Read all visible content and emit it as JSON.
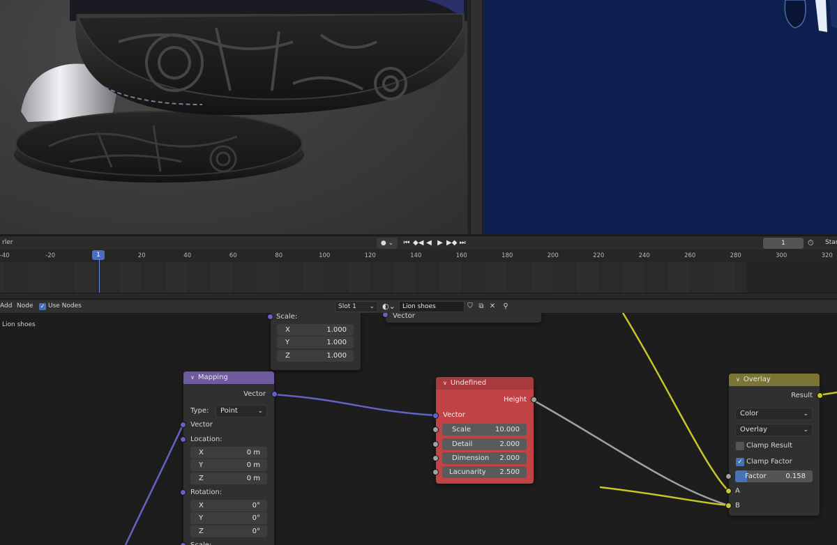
{
  "timeline": {
    "editor_label": "rler",
    "record_label": "● ⌄",
    "playback_icons": [
      "⏮",
      "◆◀",
      "◀",
      "▶",
      "▶◆",
      "⏭"
    ],
    "current_frame": "1",
    "start_label": "Star",
    "ruler_ticks": [
      "-40",
      "-20",
      "1",
      "20",
      "40",
      "60",
      "80",
      "100",
      "120",
      "140",
      "160",
      "180",
      "200",
      "220",
      "240",
      "260",
      "280",
      "300",
      "320"
    ],
    "playhead_frame": "1"
  },
  "node_header": {
    "menu_add": "Add",
    "menu_node": "Node",
    "use_nodes_label": "Use Nodes",
    "slot": "Slot 1",
    "material_name": "Lion shoes"
  },
  "breadcrumb": "Lion shoes",
  "nodes": {
    "scale_fragment": {
      "scale_label": "Scale:",
      "x_label": "X",
      "x_value": "1.000",
      "y_label": "Y",
      "y_value": "1.000",
      "z_label": "Z",
      "z_value": "1.000"
    },
    "top_fragment": {
      "vector_label": "Vector"
    },
    "mapping": {
      "title": "Mapping",
      "output_vector": "Vector",
      "type_label": "Type:",
      "type_value": "Point",
      "input_vector": "Vector",
      "location_label": "Location:",
      "loc": [
        {
          "axis": "X",
          "value": "0 m"
        },
        {
          "axis": "Y",
          "value": "0 m"
        },
        {
          "axis": "Z",
          "value": "0 m"
        }
      ],
      "rotation_label": "Rotation:",
      "rot": [
        {
          "axis": "X",
          "value": "0°"
        },
        {
          "axis": "Y",
          "value": "0°"
        },
        {
          "axis": "Z",
          "value": "0°"
        }
      ],
      "scale_label": "Scale:"
    },
    "undefined": {
      "title": "Undefined",
      "output_height": "Height",
      "input_vector": "Vector",
      "fields": [
        {
          "label": "Scale",
          "value": "10.000"
        },
        {
          "label": "Detail",
          "value": "2.000"
        },
        {
          "label": "Dimension",
          "value": "2.000"
        },
        {
          "label": "Lacunarity",
          "value": "2.500"
        }
      ]
    },
    "overlay": {
      "title": "Overlay",
      "output_result": "Result",
      "mode": "Color",
      "blend": "Overlay",
      "clamp_result": "Clamp Result",
      "clamp_factor": "Clamp Factor",
      "factor_label": "Factor",
      "factor_value": "0.158",
      "input_a": "A",
      "input_b": "B"
    }
  },
  "colors": {
    "mapping_header": "#6e5a9e",
    "undefined_header": "#a93a3d",
    "undefined_body": "#c24346",
    "overlay_header": "#7a7535",
    "vector_socket": "#6363c7",
    "color_socket": "#c7c729",
    "float_socket": "#a1a1a1",
    "uv_background": "#0c1f4f"
  }
}
